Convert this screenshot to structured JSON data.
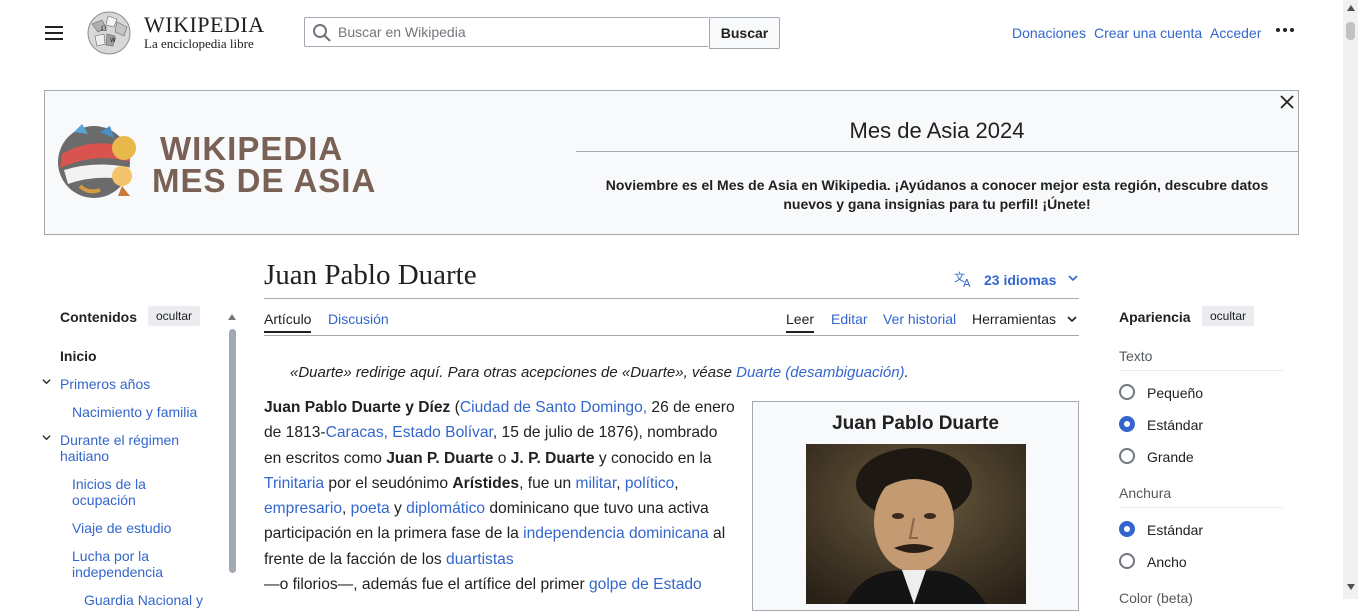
{
  "header": {
    "wordmark": "WIKIPEDIA",
    "tagline": "La enciclopedia libre",
    "search": {
      "placeholder": "Buscar en Wikipedia",
      "button_label": "Buscar"
    },
    "user_links": [
      "Donaciones",
      "Crear una cuenta",
      "Acceder"
    ]
  },
  "banner": {
    "logo_line1": "WIKIPEDIA",
    "logo_line2": "MES DE ASIA",
    "title": "Mes de Asia 2024",
    "text": "Noviembre es el Mes de Asia en Wikipedia. ¡Ayúdanos a conocer mejor esta región, descubre datos nuevos y gana insignias para tu perfil! ¡Únete!"
  },
  "toc": {
    "title": "Contenidos",
    "hide_label": "ocultar",
    "items": [
      {
        "label": "Inicio"
      },
      {
        "label": "Primeros años"
      },
      {
        "label": "Nacimiento y familia"
      },
      {
        "label": "Durante el régimen haitiano"
      },
      {
        "label": "Inicios de la ocupación"
      },
      {
        "label": "Viaje de estudio"
      },
      {
        "label": "Lucha por la independencia"
      },
      {
        "label": "Guardia Nacional y"
      }
    ]
  },
  "article": {
    "title": "Juan Pablo Duarte",
    "languages_label": "23 idiomas",
    "tabs": {
      "article": "Artículo",
      "talk": "Discusión",
      "read": "Leer",
      "edit": "Editar",
      "history": "Ver historial",
      "tools": "Herramientas"
    },
    "hatnote": {
      "prefix": "«Duarte» redirige aquí. Para otras acepciones de «Duarte», véase ",
      "link": "Duarte (desambiguación)",
      "suffix": "."
    },
    "body": {
      "p1": "Juan Pablo Duarte y Díez",
      "p2": " (",
      "l1": "Ciudad de Santo Domingo,",
      "p3": " 26 de enero de 1813-",
      "l2": "Caracas, Estado Bolívar",
      "p4": ", 15 de julio de 1876), nombrado en escritos como ",
      "b2": "Juan P. Duarte",
      "p5": " o ",
      "b3": "J. P. Duarte",
      "p6": " y conocido en la ",
      "l3": "Trinitaria",
      "p7": " por el seudónimo ",
      "b4": "Arístides",
      "p8": ", fue un ",
      "l4": "militar",
      "c1": ", ",
      "l5": "político",
      "c2": ", ",
      "l6": "empresario",
      "c3": ", ",
      "l7": "poeta",
      "p9": " y ",
      "l8": "diplomático",
      "p10": " dominicano que tuvo una activa participación en la primera fase de la ",
      "l9": "independencia dominicana",
      "p11": " al frente de la facción de los ",
      "l10": "duartistas",
      "p12": " —o filorios—, además fue el artífice del primer ",
      "l11": "golpe de Estado"
    },
    "infobox_title": "Juan Pablo Duarte"
  },
  "appearance": {
    "title": "Apariencia",
    "hide_label": "ocultar",
    "text_section": "Texto",
    "text_options": [
      "Pequeño",
      "Estándar",
      "Grande"
    ],
    "text_selected": "Estándar",
    "width_section": "Anchura",
    "width_options": [
      "Estándar",
      "Ancho"
    ],
    "width_selected": "Estándar",
    "color_section": "Color (beta)"
  },
  "colors": {
    "link": "#3366cc",
    "text": "#202122",
    "border": "#a2a9b1",
    "banner_logo": "#7a6156"
  }
}
